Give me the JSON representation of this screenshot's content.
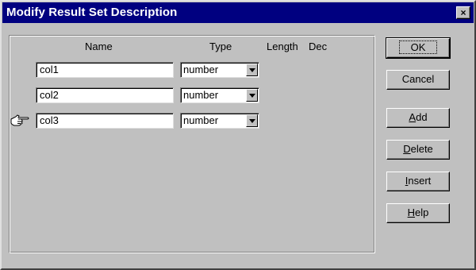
{
  "dialog": {
    "title": "Modify Result Set Description",
    "close_label": "×"
  },
  "columns_header": {
    "name": "Name",
    "type": "Type",
    "length": "Length",
    "dec": "Dec"
  },
  "rows": [
    {
      "name": "col1",
      "type": "number"
    },
    {
      "name": "col2",
      "type": "number"
    },
    {
      "name": "col3",
      "type": "number"
    }
  ],
  "buttons": {
    "ok": "OK",
    "cancel": "Cancel",
    "add_first": "A",
    "add_rest": "dd",
    "delete_first": "D",
    "delete_rest": "elete",
    "insert_first": "I",
    "insert_rest": "nsert",
    "help_first": "H",
    "help_rest": "elp"
  },
  "icons": {
    "current_row": "pointing-hand-icon",
    "close": "close-icon",
    "dropdown": "dropdown-arrow-icon"
  }
}
